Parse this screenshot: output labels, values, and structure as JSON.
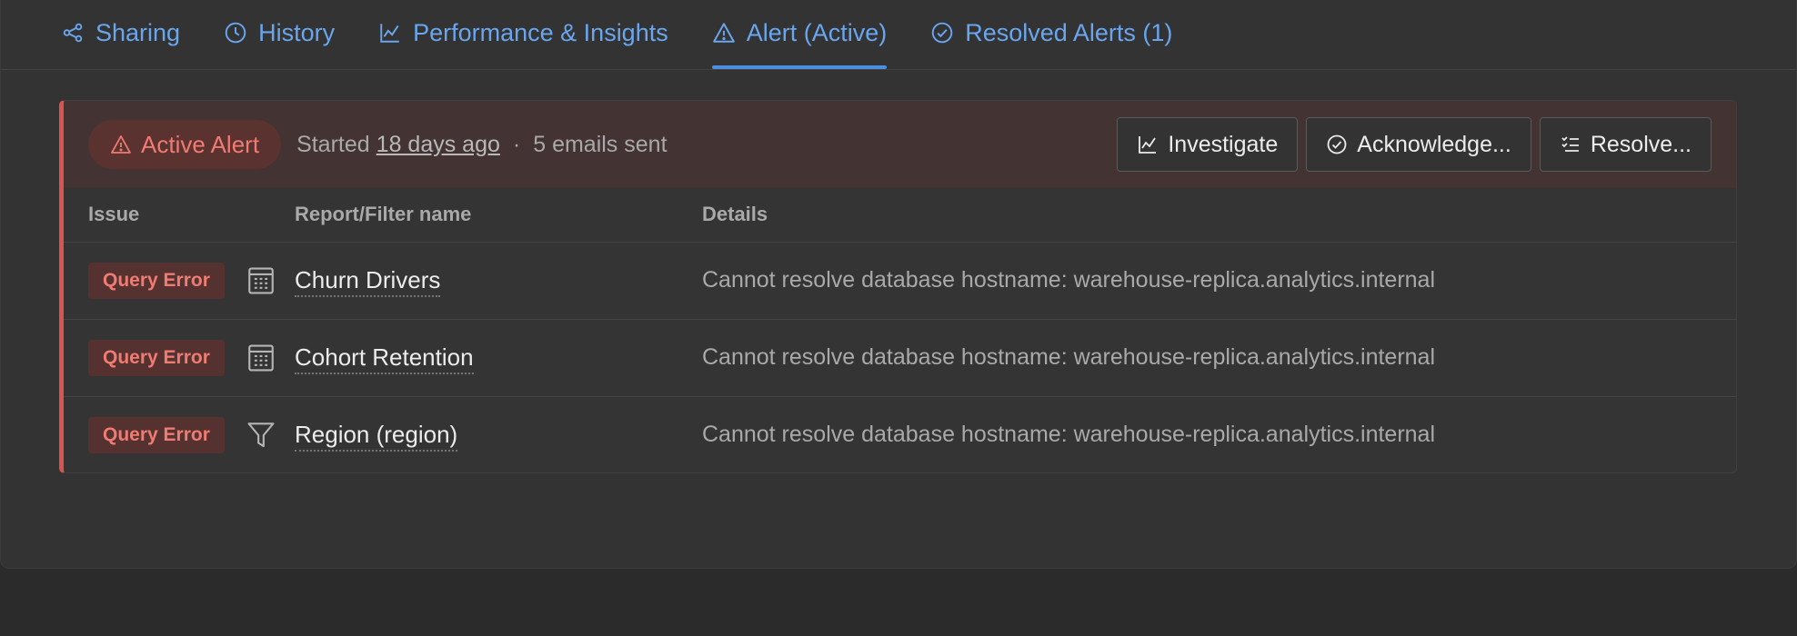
{
  "tabs": [
    {
      "label": "Sharing",
      "icon": "share-icon"
    },
    {
      "label": "History",
      "icon": "clock-icon"
    },
    {
      "label": "Performance & Insights",
      "icon": "line-chart-icon"
    },
    {
      "label": "Alert (Active)",
      "icon": "warning-icon",
      "active": true
    },
    {
      "label": "Resolved Alerts (1)",
      "icon": "check-circle-icon"
    }
  ],
  "alert": {
    "status_label": "Active Alert",
    "started_prefix": "Started",
    "started_ago": "18 days ago",
    "separator": "·",
    "emails_sent": "5 emails sent",
    "actions": {
      "investigate": "Investigate",
      "acknowledge": "Acknowledge...",
      "resolve": "Resolve..."
    }
  },
  "table": {
    "headers": {
      "issue": "Issue",
      "name": "Report/Filter name",
      "details": "Details"
    },
    "rows": [
      {
        "issue": "Query Error",
        "type_icon": "report-icon",
        "name": "Churn Drivers",
        "details": "Cannot resolve database hostname: warehouse-replica.analytics.internal"
      },
      {
        "issue": "Query Error",
        "type_icon": "report-icon",
        "name": "Cohort Retention",
        "details": "Cannot resolve database hostname: warehouse-replica.analytics.internal"
      },
      {
        "issue": "Query Error",
        "type_icon": "filter-icon",
        "name": "Region (region)",
        "details": "Cannot resolve database hostname: warehouse-replica.analytics.internal"
      }
    ]
  },
  "colors": {
    "accent": "#6aa6ee",
    "danger": "#f07b73",
    "danger_border": "#d9534f"
  }
}
